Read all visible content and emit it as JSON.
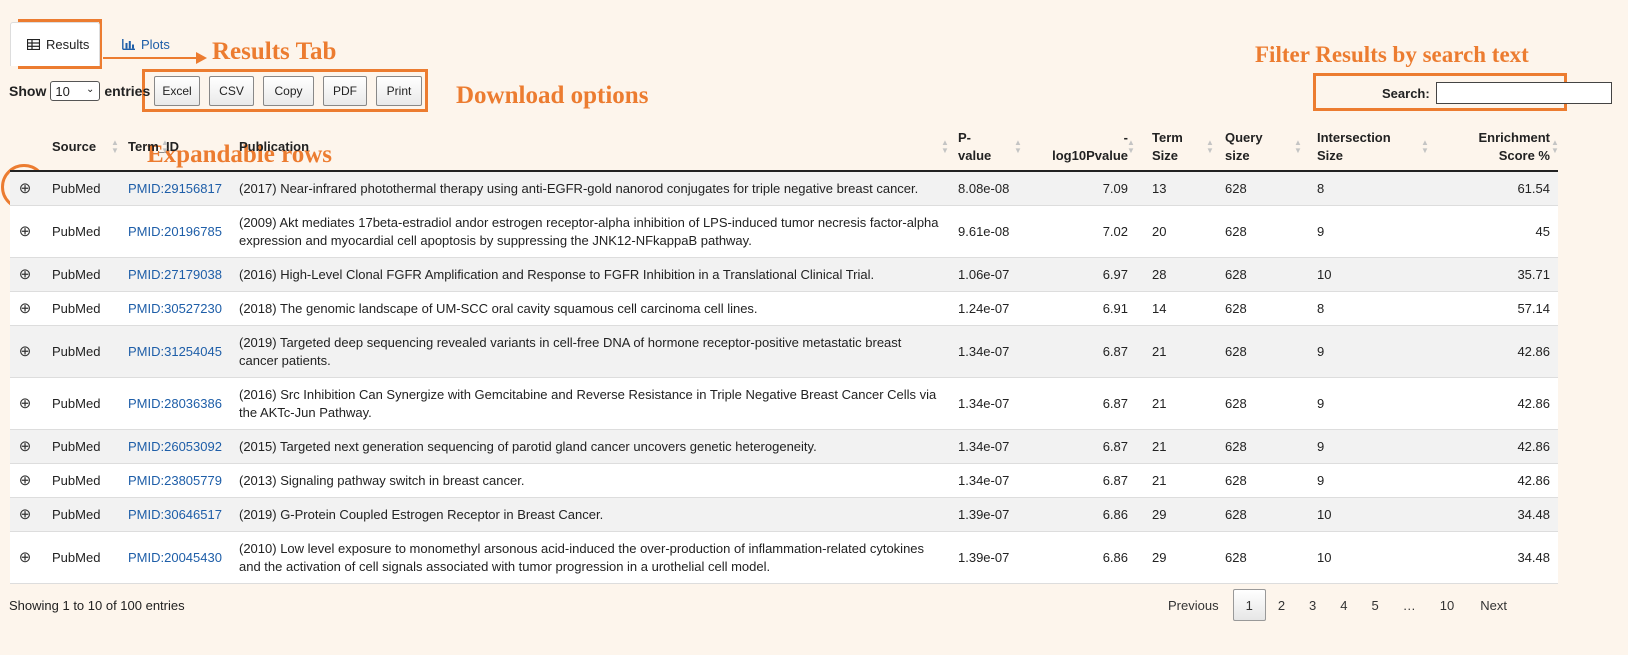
{
  "annotations": {
    "results_tab": "Results Tab",
    "download_options": "Download options",
    "filter_results": "Filter  Results by search text",
    "expandable_rows": "Expandable rows"
  },
  "tabs": [
    {
      "label": "Results",
      "icon": "table-icon",
      "active": true
    },
    {
      "label": "Plots",
      "icon": "bar-chart-icon",
      "active": false
    }
  ],
  "length_menu": {
    "show_label": "Show",
    "selected": "10",
    "entries_label": "entries"
  },
  "export_buttons": [
    "Excel",
    "CSV",
    "Copy",
    "PDF",
    "Print"
  ],
  "search": {
    "label": "Search:",
    "value": ""
  },
  "columns": [
    {
      "key": "expand",
      "label": ""
    },
    {
      "key": "source",
      "label": "Source"
    },
    {
      "key": "term_id",
      "label": "Term_ID"
    },
    {
      "key": "publication",
      "label": "Publication"
    },
    {
      "key": "pvalue",
      "label": "P-\nvalue"
    },
    {
      "key": "log10p",
      "label": "-\nlog10Pvalue"
    },
    {
      "key": "term_size",
      "label": "Term\nSize"
    },
    {
      "key": "query_size",
      "label": "Query\nsize"
    },
    {
      "key": "intersection",
      "label": "Intersection\nSize"
    },
    {
      "key": "enrichment",
      "label": "Enrichment\nScore %"
    }
  ],
  "rows": [
    {
      "source": "PubMed",
      "term_id": "PMID:29156817",
      "publication": "(2017) Near-infrared photothermal therapy using anti-EGFR-gold nanorod conjugates for triple negative breast cancer.",
      "pvalue": "8.08e-08",
      "log10p": "7.09",
      "term_size": "13",
      "query_size": "628",
      "intersection": "8",
      "enrichment": "61.54"
    },
    {
      "source": "PubMed",
      "term_id": "PMID:20196785",
      "publication": "(2009) Akt mediates 17beta-estradiol andor estrogen receptor-alpha inhibition of LPS-induced tumor necresis factor-alpha expression and myocardial cell apoptosis by suppressing the JNK12-NFkappaB pathway.",
      "pvalue": "9.61e-08",
      "log10p": "7.02",
      "term_size": "20",
      "query_size": "628",
      "intersection": "9",
      "enrichment": "45"
    },
    {
      "source": "PubMed",
      "term_id": "PMID:27179038",
      "publication": "(2016) High-Level Clonal FGFR Amplification and Response to FGFR Inhibition in a Translational Clinical Trial.",
      "pvalue": "1.06e-07",
      "log10p": "6.97",
      "term_size": "28",
      "query_size": "628",
      "intersection": "10",
      "enrichment": "35.71"
    },
    {
      "source": "PubMed",
      "term_id": "PMID:30527230",
      "publication": "(2018) The genomic landscape of UM-SCC oral cavity squamous cell carcinoma cell lines.",
      "pvalue": "1.24e-07",
      "log10p": "6.91",
      "term_size": "14",
      "query_size": "628",
      "intersection": "8",
      "enrichment": "57.14"
    },
    {
      "source": "PubMed",
      "term_id": "PMID:31254045",
      "publication": "(2019) Targeted deep sequencing revealed variants in cell-free DNA of hormone receptor-positive metastatic breast cancer patients.",
      "pvalue": "1.34e-07",
      "log10p": "6.87",
      "term_size": "21",
      "query_size": "628",
      "intersection": "9",
      "enrichment": "42.86"
    },
    {
      "source": "PubMed",
      "term_id": "PMID:28036386",
      "publication": "(2016) Src Inhibition Can Synergize with Gemcitabine and Reverse Resistance in Triple Negative Breast Cancer Cells via the AKTc-Jun Pathway.",
      "pvalue": "1.34e-07",
      "log10p": "6.87",
      "term_size": "21",
      "query_size": "628",
      "intersection": "9",
      "enrichment": "42.86"
    },
    {
      "source": "PubMed",
      "term_id": "PMID:26053092",
      "publication": "(2015) Targeted next generation sequencing of parotid gland cancer uncovers genetic heterogeneity.",
      "pvalue": "1.34e-07",
      "log10p": "6.87",
      "term_size": "21",
      "query_size": "628",
      "intersection": "9",
      "enrichment": "42.86"
    },
    {
      "source": "PubMed",
      "term_id": "PMID:23805779",
      "publication": "(2013) Signaling pathway switch in breast cancer.",
      "pvalue": "1.34e-07",
      "log10p": "6.87",
      "term_size": "21",
      "query_size": "628",
      "intersection": "9",
      "enrichment": "42.86"
    },
    {
      "source": "PubMed",
      "term_id": "PMID:30646517",
      "publication": "(2019) G-Protein Coupled Estrogen Receptor in Breast Cancer.",
      "pvalue": "1.39e-07",
      "log10p": "6.86",
      "term_size": "29",
      "query_size": "628",
      "intersection": "10",
      "enrichment": "34.48"
    },
    {
      "source": "PubMed",
      "term_id": "PMID:20045430",
      "publication": "(2010) Low level exposure to monomethyl arsonous acid-induced the over-production of inflammation-related cytokines and the activation of cell signals associated with tumor progression in a urothelial cell model.",
      "pvalue": "1.39e-07",
      "log10p": "6.86",
      "term_size": "29",
      "query_size": "628",
      "intersection": "10",
      "enrichment": "34.48"
    }
  ],
  "info": "Showing 1 to 10 of 100 entries",
  "pagination": {
    "previous": "Previous",
    "pages": [
      "1",
      "2",
      "3",
      "4",
      "5",
      "…",
      "10"
    ],
    "current": "1",
    "next": "Next"
  },
  "colors": {
    "accent": "#ec7c30",
    "link": "#1e5ea8",
    "background": "#fdf5ec"
  }
}
